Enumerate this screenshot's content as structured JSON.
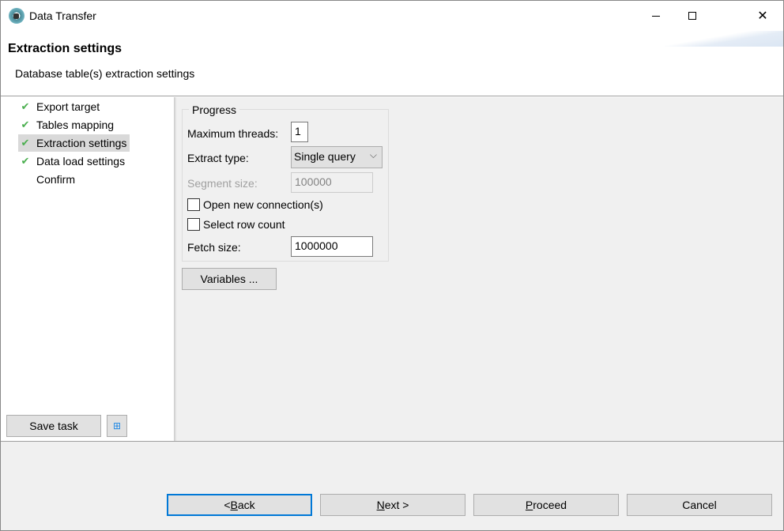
{
  "window": {
    "title": "Data Transfer",
    "icon": "dbeaver-logo-icon",
    "controls": [
      "minimize-icon",
      "maximize-icon",
      "close-icon"
    ]
  },
  "header": {
    "title": "Extraction settings",
    "description": "Database table(s) extraction settings"
  },
  "steps": [
    {
      "label": "Export target",
      "done": true
    },
    {
      "label": "Tables mapping",
      "done": true
    },
    {
      "label": "Extraction settings",
      "done": true,
      "selected": true
    },
    {
      "label": "Data load settings",
      "done": true
    },
    {
      "label": "Confirm",
      "done": false
    }
  ],
  "progress": {
    "group_label": "Progress",
    "max_threads_label": "Maximum threads:",
    "max_threads_value": "1",
    "extract_type_label": "Extract type:",
    "extract_type_value": "Single query",
    "segment_size_label": "Segment size:",
    "segment_size_value": "100000",
    "open_new_connection_label": "Open new connection(s)",
    "open_new_connection_checked": false,
    "select_row_count_label": "Select row count",
    "select_row_count_checked": false,
    "fetch_size_label": "Fetch size:",
    "fetch_size_value": "1000000"
  },
  "variables_label": "Variables ...",
  "save_task_label": "Save task",
  "task_icon": "tasks-icon",
  "buttons": {
    "back": {
      "pre": "< ",
      "mn": "B",
      "rest": "ack"
    },
    "next": {
      "pre": "",
      "mn": "N",
      "rest": "ext >"
    },
    "proceed": {
      "pre": "",
      "mn": "P",
      "rest": "roceed"
    },
    "cancel": "Cancel"
  },
  "colors": {
    "check": "#4caf50",
    "focus": "#0078d7"
  }
}
